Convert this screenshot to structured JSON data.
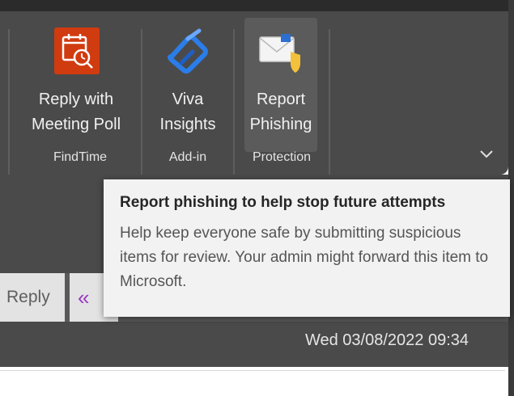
{
  "ribbon": {
    "buttons": [
      {
        "id": "reply-with-meeting-poll",
        "label_line1": "Reply with",
        "label_line2": "Meeting Poll",
        "icon": "calendar-clock-icon",
        "color": "#d13b10"
      },
      {
        "id": "viva-insights",
        "label_line1": "Viva",
        "label_line2": "Insights",
        "icon": "viva-insights-icon",
        "color": "#2b7de9"
      },
      {
        "id": "report-phishing",
        "label_line1": "Report",
        "label_line2": "Phishing",
        "icon": "envelope-shield-icon",
        "color": "#f3c13a"
      }
    ],
    "groups": [
      {
        "label": "FindTime"
      },
      {
        "label": "Add-in"
      },
      {
        "label": "Protection"
      }
    ],
    "collapse_icon": "chevron-down-icon"
  },
  "tooltip": {
    "title": "Report phishing to help stop future attempts",
    "body": "Help keep everyone safe by submitting suspicious items for review. Your admin might forward this item to Microsoft."
  },
  "message_actions": {
    "reply_label": "Reply",
    "reply_all_icon": "reply-all-icon"
  },
  "message": {
    "datetime": "Wed 03/08/2022 09:34"
  },
  "colors": {
    "ribbon_bg": "#4a4a4a",
    "tooltip_bg": "#f2f2f2",
    "accent_purple": "#9a39c4"
  }
}
